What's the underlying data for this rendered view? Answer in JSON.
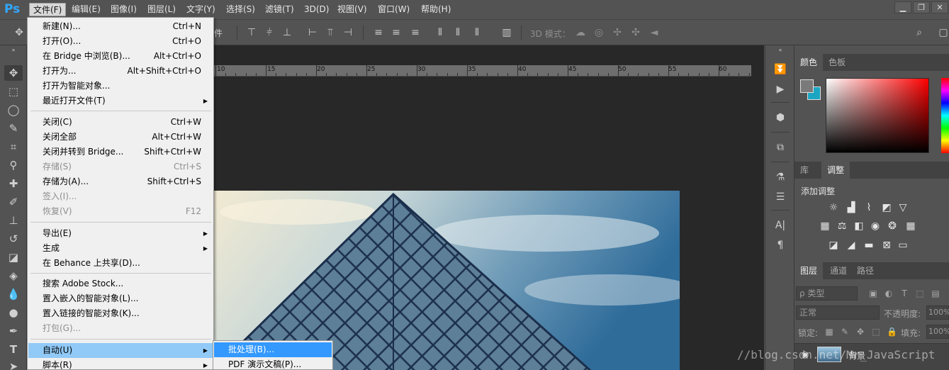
{
  "app": {
    "logo": "Ps"
  },
  "menubar": {
    "items": [
      "文件(F)",
      "编辑(E)",
      "图像(I)",
      "图层(L)",
      "文字(Y)",
      "选择(S)",
      "滤镜(T)",
      "3D(D)",
      "视图(V)",
      "窗口(W)",
      "帮助(H)"
    ],
    "active_index": 0,
    "window_controls": [
      "minimize-icon",
      "restore-icon",
      "close-icon"
    ]
  },
  "options_bar": {
    "partial_label": "件",
    "mode3d_label": "3D 模式："
  },
  "ruler": {
    "labels": [
      "10",
      "15",
      "20",
      "25",
      "30",
      "35",
      "40",
      "45",
      "50",
      "55",
      "60"
    ]
  },
  "file_menu": {
    "items": [
      {
        "label": "新建(N)...",
        "shortcut": "Ctrl+N"
      },
      {
        "label": "打开(O)...",
        "shortcut": "Ctrl+O"
      },
      {
        "label": "在 Bridge 中浏览(B)...",
        "shortcut": "Alt+Ctrl+O"
      },
      {
        "label": "打开为...",
        "shortcut": "Alt+Shift+Ctrl+O"
      },
      {
        "label": "打开为智能对象...",
        "shortcut": ""
      },
      {
        "label": "最近打开文件(T)",
        "shortcut": "",
        "submenu": true
      },
      {
        "label": "关闭(C)",
        "shortcut": "Ctrl+W"
      },
      {
        "label": "关闭全部",
        "shortcut": "Alt+Ctrl+W"
      },
      {
        "label": "关闭并转到 Bridge...",
        "shortcut": "Shift+Ctrl+W"
      },
      {
        "label": "存储(S)",
        "shortcut": "Ctrl+S",
        "disabled": true
      },
      {
        "label": "存储为(A)...",
        "shortcut": "Shift+Ctrl+S"
      },
      {
        "label": "签入(I)...",
        "shortcut": "",
        "disabled": true
      },
      {
        "label": "恢复(V)",
        "shortcut": "F12",
        "disabled": true
      },
      {
        "label": "导出(E)",
        "shortcut": "",
        "submenu": true
      },
      {
        "label": "生成",
        "shortcut": "",
        "submenu": true
      },
      {
        "label": "在 Behance 上共享(D)...",
        "shortcut": ""
      },
      {
        "label": "搜索 Adobe Stock...",
        "shortcut": ""
      },
      {
        "label": "置入嵌入的智能对象(L)...",
        "shortcut": ""
      },
      {
        "label": "置入链接的智能对象(K)...",
        "shortcut": ""
      },
      {
        "label": "打包(G)...",
        "shortcut": "",
        "disabled": true
      },
      {
        "label": "自动(U)",
        "shortcut": "",
        "submenu": true,
        "highlight": true
      },
      {
        "label": "脚本(R)",
        "shortcut": "",
        "submenu": true
      }
    ]
  },
  "auto_submenu": {
    "items": [
      "批处理(B)...",
      "PDF 演示文稿(P)..."
    ],
    "highlight_index": 0
  },
  "color_panel": {
    "tabs": [
      "颜色",
      "色板"
    ],
    "active_tab": 0,
    "foreground": "#7a7a7a",
    "background": "#1aa6c2"
  },
  "adjust_panel": {
    "tabs": [
      "库",
      "调整"
    ],
    "active_tab": 1,
    "title": "添加调整"
  },
  "layers_panel": {
    "tabs": [
      "图层",
      "通道",
      "路径"
    ],
    "active_tab": 0,
    "filter_placeholder": "ρ 类型",
    "blend_mode": "正常",
    "opacity_label": "不透明度:",
    "opacity_value": "100%",
    "lock_label": "锁定:",
    "fill_label": "填充:",
    "fill_value": "100%",
    "layer_name": "背景"
  },
  "watermark": "//blog.csdn.net/Mr_JavaScript"
}
